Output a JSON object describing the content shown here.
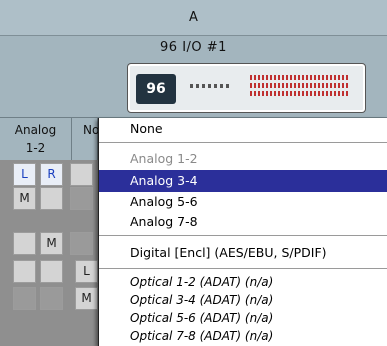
{
  "header": {
    "column_label": "A"
  },
  "device": {
    "name": "96 I/O #1",
    "badge": "96"
  },
  "columns": [
    {
      "label_line1": "Analog",
      "label_line2": "1-2"
    },
    {
      "label_line1": "No",
      "label_line2": ""
    }
  ],
  "grid": {
    "row1": [
      "L",
      "R"
    ],
    "row2": [
      "M"
    ],
    "row3": [
      "M"
    ],
    "row4": [
      "L"
    ],
    "row5": [
      "M"
    ]
  },
  "menu": {
    "items": [
      {
        "label": "None"
      },
      {
        "label": "Analog 1-2"
      },
      {
        "label": "Analog 3-4"
      },
      {
        "label": "Analog 5-6"
      },
      {
        "label": "Analog 7-8"
      },
      {
        "label": "Digital [Encl] (AES/EBU, S/PDIF)"
      },
      {
        "label": "Optical 1-2 (ADAT) (n/a)"
      },
      {
        "label": "Optical 3-4 (ADAT) (n/a)"
      },
      {
        "label": "Optical 5-6 (ADAT) (n/a)"
      },
      {
        "label": "Optical 7-8 (ADAT) (n/a)"
      }
    ],
    "selected_label": "Analog 3-4",
    "disabled_label": "Analog 1-2"
  },
  "colors": {
    "selection": "#2b2f9a",
    "header_bg": "#aebfc8",
    "blue_text": "#1a3fbf"
  }
}
